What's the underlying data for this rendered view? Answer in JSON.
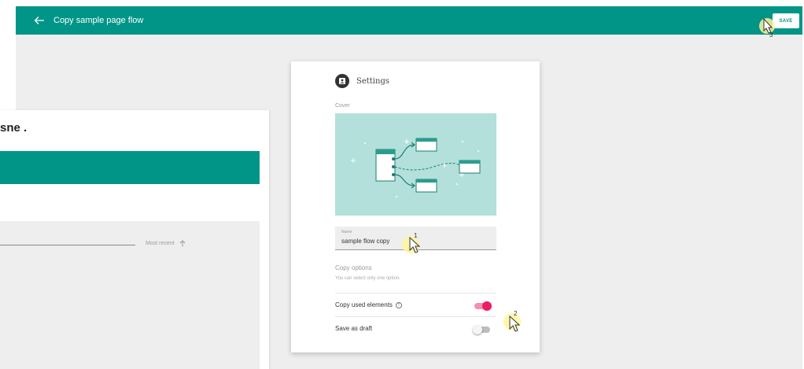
{
  "topbar": {
    "title": "Copy sample page flow",
    "save_label": "SAVE"
  },
  "background_page": {
    "heading_fragment": "sne .",
    "sort_label": "Most recent"
  },
  "dialog": {
    "title": "Settings",
    "cover_label": "Cover",
    "name_field": {
      "label": "Name",
      "value": "sample flow copy"
    },
    "copy_options_title": "Copy options",
    "copy_options_hint": "You can select only one option.",
    "options": [
      {
        "label": "Copy used elements",
        "has_help": true,
        "enabled": true
      },
      {
        "label": "Save as draft",
        "has_help": false,
        "enabled": false
      }
    ]
  },
  "markers": [
    "1",
    "2",
    "3"
  ],
  "icons": {
    "back": "arrow-left-icon",
    "settings": "settings-avatar-icon",
    "help": "help-circle-icon",
    "sort": "arrow-up-icon",
    "cursor": "cursor-pointer-icon"
  },
  "colors": {
    "primary": "#009587",
    "toggle_on": "#e91e63",
    "cover_bg": "#b3e0db",
    "marker": "#fff59d"
  }
}
